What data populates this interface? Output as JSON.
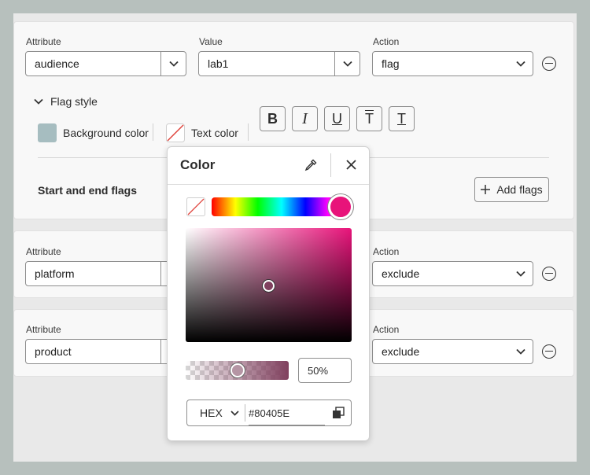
{
  "rows": [
    {
      "attribute_label": "Attribute",
      "attribute_value": "audience",
      "value_label": "Value",
      "value_value": "lab1",
      "action_label": "Action",
      "action_value": "flag"
    },
    {
      "attribute_label": "Attribute",
      "attribute_value": "platform",
      "action_label": "Action",
      "action_value": "exclude"
    },
    {
      "attribute_label": "Attribute",
      "attribute_value": "product",
      "action_label": "Action",
      "action_value": "exclude"
    }
  ],
  "flag_style": {
    "title": "Flag style",
    "background_label": "Background color",
    "background_color": "#A6BDC0",
    "text_label": "Text color",
    "bold": "B",
    "italic": "I",
    "underline": "U",
    "overline": "T",
    "strike": "T"
  },
  "flags": {
    "title": "Start and end flags",
    "add_label": "Add flags"
  },
  "color_popover": {
    "title": "Color",
    "hue_color": "#E8137A",
    "opacity": "50%",
    "format": "HEX",
    "hex_value": "#80405E"
  }
}
